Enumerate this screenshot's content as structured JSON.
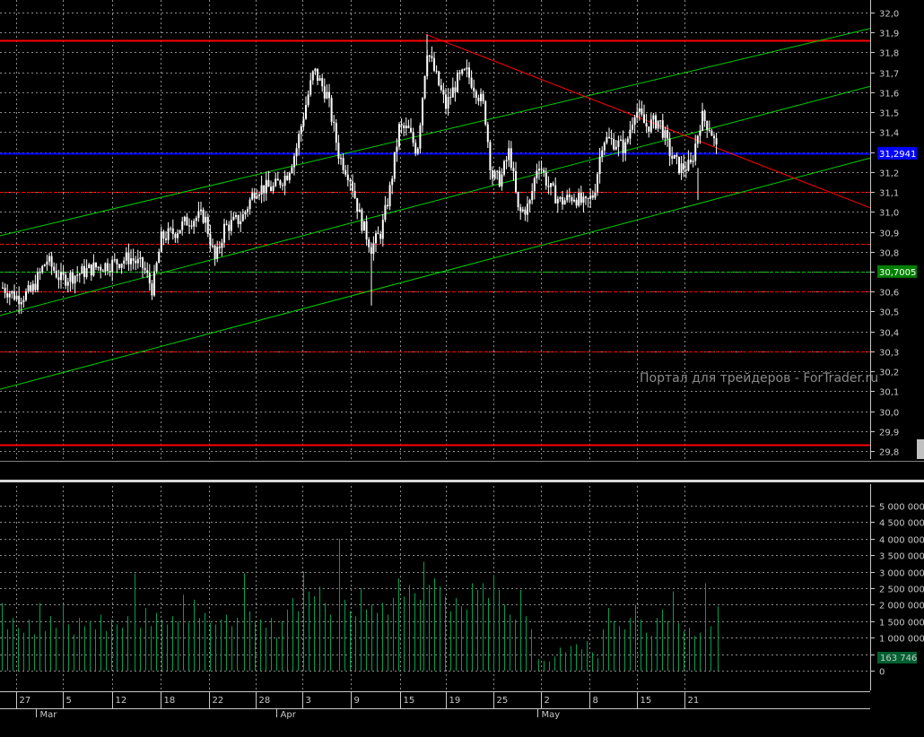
{
  "chart_data": [
    {
      "type": "candlestick",
      "panel": "price",
      "y_ticks": [
        "32,0",
        "31,9",
        "31,8",
        "31,7",
        "31,6",
        "31,5",
        "31,4",
        "31,3",
        "31,2",
        "31,1",
        "31,0",
        "30,9",
        "30,8",
        "30,7",
        "30,6",
        "30,5",
        "30,4",
        "30,3",
        "30,2",
        "30,1",
        "30,0",
        "29,9",
        "29,8"
      ],
      "ylim": [
        29.75,
        32.05
      ],
      "grid": true,
      "watermark": "Портал для трейдеров - ForTrader.ru",
      "price_labels": [
        {
          "text": "31,2941",
          "value": 31.2941,
          "color": "#0000ff"
        },
        {
          "text": "30,7005",
          "value": 30.7005,
          "color": "#008000"
        }
      ],
      "horizontal_lines": [
        {
          "value": 31.86,
          "color": "#ff0000",
          "style": "solid"
        },
        {
          "value": 31.2941,
          "color": "#0000ff",
          "style": "solid"
        },
        {
          "value": 31.1,
          "color": "#ff0000",
          "style": "dashed"
        },
        {
          "value": 30.84,
          "color": "#ff0000",
          "style": "dashed"
        },
        {
          "value": 30.7005,
          "color": "#00cc00",
          "style": "dashed"
        },
        {
          "value": 30.6,
          "color": "#ff0000",
          "style": "dashed"
        },
        {
          "value": 30.3,
          "color": "#ff0000",
          "style": "dashed"
        },
        {
          "value": 29.83,
          "color": "#ff0000",
          "style": "solid"
        }
      ],
      "trend_lines": [
        {
          "x": [
            0,
            970
          ],
          "y": [
            30.88,
            31.92
          ],
          "color": "#00cc00"
        },
        {
          "x": [
            0,
            970
          ],
          "y": [
            30.48,
            31.63
          ],
          "color": "#00cc00"
        },
        {
          "x": [
            0,
            970
          ],
          "y": [
            30.11,
            31.27
          ],
          "color": "#00cc00"
        },
        {
          "x": [
            475,
            970
          ],
          "y": [
            31.89,
            31.02
          ],
          "color": "#ff0000"
        }
      ],
      "x_ticks": [
        {
          "label": "27",
          "x": 18
        },
        {
          "label": "5",
          "x": 70
        },
        {
          "label": "12",
          "x": 125
        },
        {
          "label": "18",
          "x": 179
        },
        {
          "label": "22",
          "x": 233
        },
        {
          "label": "28",
          "x": 285
        },
        {
          "label": "3",
          "x": 337
        },
        {
          "label": "9",
          "x": 391
        },
        {
          "label": "15",
          "x": 446
        },
        {
          "label": "19",
          "x": 497
        },
        {
          "label": "25",
          "x": 550
        },
        {
          "label": "2",
          "x": 603
        },
        {
          "label": "8",
          "x": 657
        },
        {
          "label": "15",
          "x": 710
        },
        {
          "label": "21",
          "x": 763
        }
      ],
      "month_labels": [
        {
          "label": "Mar",
          "x": 44
        },
        {
          "label": "Apr",
          "x": 312
        },
        {
          "label": "May",
          "x": 603
        }
      ],
      "x_range": [
        0,
        970
      ],
      "path": [
        [
          3,
          30.62
        ],
        [
          20,
          30.57
        ],
        [
          35,
          30.6
        ],
        [
          52,
          30.76
        ],
        [
          68,
          30.66
        ],
        [
          88,
          30.69
        ],
        [
          105,
          30.72
        ],
        [
          125,
          30.74
        ],
        [
          145,
          30.77
        ],
        [
          160,
          30.72
        ],
        [
          170,
          30.61
        ],
        [
          180,
          30.87
        ],
        [
          195,
          30.9
        ],
        [
          210,
          30.96
        ],
        [
          228,
          30.98
        ],
        [
          240,
          30.75
        ],
        [
          250,
          30.92
        ],
        [
          270,
          30.97
        ],
        [
          285,
          31.12
        ],
        [
          305,
          31.12
        ],
        [
          320,
          31.19
        ],
        [
          330,
          31.31
        ],
        [
          340,
          31.52
        ],
        [
          350,
          31.71
        ],
        [
          365,
          31.58
        ],
        [
          378,
          31.28
        ],
        [
          390,
          31.18
        ],
        [
          402,
          30.96
        ],
        [
          414,
          30.82
        ],
        [
          425,
          30.9
        ],
        [
          435,
          31.12
        ],
        [
          445,
          31.42
        ],
        [
          455,
          31.41
        ],
        [
          465,
          31.3
        ],
        [
          476,
          31.82
        ],
        [
          486,
          31.68
        ],
        [
          497,
          31.53
        ],
        [
          510,
          31.66
        ],
        [
          520,
          31.7
        ],
        [
          530,
          31.62
        ],
        [
          540,
          31.52
        ],
        [
          548,
          31.18
        ],
        [
          558,
          31.16
        ],
        [
          568,
          31.31
        ],
        [
          578,
          30.99
        ],
        [
          590,
          31.03
        ],
        [
          600,
          31.26
        ],
        [
          612,
          31.12
        ],
        [
          625,
          31.05
        ],
        [
          640,
          31.08
        ],
        [
          652,
          31.03
        ],
        [
          662,
          31.09
        ],
        [
          672,
          31.37
        ],
        [
          685,
          31.35
        ],
        [
          697,
          31.32
        ],
        [
          708,
          31.52
        ],
        [
          720,
          31.43
        ],
        [
          735,
          31.46
        ],
        [
          748,
          31.28
        ],
        [
          758,
          31.22
        ],
        [
          770,
          31.23
        ],
        [
          782,
          31.48
        ],
        [
          792,
          31.42
        ],
        [
          800,
          31.29
        ]
      ]
    },
    {
      "type": "bar",
      "panel": "volume",
      "y_ticks": [
        "5 000 000",
        "4 500 000",
        "4 000 000",
        "3 500 000",
        "3 000 000",
        "2 500 000",
        "2 000 000",
        "1 500 000",
        "1 000 000",
        "500 000",
        "0"
      ],
      "ylim": [
        0,
        5250000
      ],
      "current_label": "163 746",
      "current_value": 163746,
      "bar_color": "#00a050",
      "grid": true,
      "x_range": [
        0,
        970
      ],
      "bars": [
        [
          2,
          2050000
        ],
        [
          8,
          1250000
        ],
        [
          14,
          1600000
        ],
        [
          20,
          1300000
        ],
        [
          26,
          1150000
        ],
        [
          32,
          1550000
        ],
        [
          38,
          1100000
        ],
        [
          44,
          2050000
        ],
        [
          50,
          1200000
        ],
        [
          56,
          1650000
        ],
        [
          62,
          1300000
        ],
        [
          70,
          2000000
        ],
        [
          76,
          1400000
        ],
        [
          82,
          1100000
        ],
        [
          88,
          1600000
        ],
        [
          94,
          1350000
        ],
        [
          100,
          1500000
        ],
        [
          106,
          1250000
        ],
        [
          112,
          1700000
        ],
        [
          118,
          1200000
        ],
        [
          124,
          1550000
        ],
        [
          130,
          1400000
        ],
        [
          136,
          1300000
        ],
        [
          142,
          1650000
        ],
        [
          150,
          2950000
        ],
        [
          156,
          1300000
        ],
        [
          162,
          1900000
        ],
        [
          168,
          1350000
        ],
        [
          174,
          1750000
        ],
        [
          180,
          1550000
        ],
        [
          186,
          1400000
        ],
        [
          192,
          1650000
        ],
        [
          198,
          1500000
        ],
        [
          204,
          2300000
        ],
        [
          210,
          1450000
        ],
        [
          216,
          2150000
        ],
        [
          222,
          1600000
        ],
        [
          228,
          1750000
        ],
        [
          234,
          1450000
        ],
        [
          240,
          1400000
        ],
        [
          246,
          1550000
        ],
        [
          252,
          1700000
        ],
        [
          258,
          1350000
        ],
        [
          264,
          1600000
        ],
        [
          272,
          2950000
        ],
        [
          278,
          1800000
        ],
        [
          284,
          1500000
        ],
        [
          290,
          1550000
        ],
        [
          296,
          1300000
        ],
        [
          302,
          1600000
        ],
        [
          308,
          1000000
        ],
        [
          314,
          1500000
        ],
        [
          320,
          1850000
        ],
        [
          326,
          2200000
        ],
        [
          332,
          1800000
        ],
        [
          338,
          3000000
        ],
        [
          344,
          2400000
        ],
        [
          350,
          2250000
        ],
        [
          356,
          2550000
        ],
        [
          362,
          2050000
        ],
        [
          368,
          1700000
        ],
        [
          378,
          4000000
        ],
        [
          384,
          2150000
        ],
        [
          390,
          1800000
        ],
        [
          396,
          1650000
        ],
        [
          402,
          2500000
        ],
        [
          408,
          1850000
        ],
        [
          414,
          2000000
        ],
        [
          420,
          1750000
        ],
        [
          426,
          2050000
        ],
        [
          432,
          1700000
        ],
        [
          438,
          2200000
        ],
        [
          444,
          2800000
        ],
        [
          450,
          2250000
        ],
        [
          456,
          2600000
        ],
        [
          462,
          2350000
        ],
        [
          468,
          2150000
        ],
        [
          472,
          3300000
        ],
        [
          478,
          2600000
        ],
        [
          484,
          2800000
        ],
        [
          490,
          2550000
        ],
        [
          496,
          2250000
        ],
        [
          502,
          1800000
        ],
        [
          508,
          2200000
        ],
        [
          514,
          1950000
        ],
        [
          520,
          1850000
        ],
        [
          526,
          2650000
        ],
        [
          532,
          2450000
        ],
        [
          538,
          2650000
        ],
        [
          544,
          2200000
        ],
        [
          550,
          2900000
        ],
        [
          556,
          2450000
        ],
        [
          562,
          2000000
        ],
        [
          568,
          1700000
        ],
        [
          574,
          1550000
        ],
        [
          580,
          2450000
        ],
        [
          586,
          1650000
        ],
        [
          592,
          1250000
        ],
        [
          600,
          350000
        ],
        [
          606,
          300000
        ],
        [
          612,
          280000
        ],
        [
          618,
          420000
        ],
        [
          624,
          700000
        ],
        [
          630,
          550000
        ],
        [
          636,
          750000
        ],
        [
          642,
          800000
        ],
        [
          648,
          650000
        ],
        [
          654,
          900000
        ],
        [
          660,
          550000
        ],
        [
          666,
          380000
        ],
        [
          672,
          1250000
        ],
        [
          678,
          1900000
        ],
        [
          684,
          1500000
        ],
        [
          690,
          1350000
        ],
        [
          696,
          1250000
        ],
        [
          702,
          1600000
        ],
        [
          708,
          2000000
        ],
        [
          714,
          1550000
        ],
        [
          720,
          1150000
        ],
        [
          726,
          1050000
        ],
        [
          732,
          1600000
        ],
        [
          738,
          1850000
        ],
        [
          744,
          1500000
        ],
        [
          750,
          2400000
        ],
        [
          756,
          1450000
        ],
        [
          762,
          1200000
        ],
        [
          768,
          1300000
        ],
        [
          774,
          1050000
        ],
        [
          780,
          1150000
        ],
        [
          786,
          2650000
        ],
        [
          792,
          1350000
        ],
        [
          800,
          1950000
        ]
      ]
    }
  ]
}
